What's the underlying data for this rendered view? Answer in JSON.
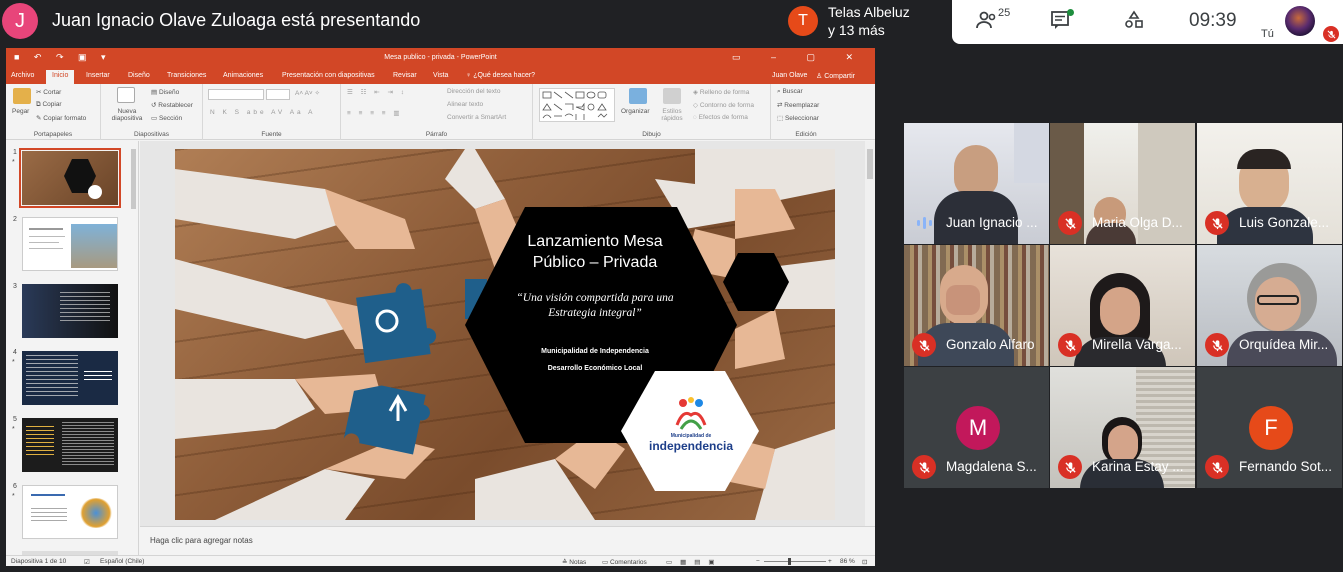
{
  "meet": {
    "presenter_initial": "J",
    "presenter_text": "Juan Ignacio Olave Zuloaga está presentando",
    "other_presentation": {
      "initial": "T",
      "line1": "Telas Albeluz",
      "line2": "y 13 más"
    },
    "participants_count": "25",
    "time": "09:39",
    "you_label": "Tú"
  },
  "powerpoint": {
    "window_title": "Mesa publico - privada - PowerPoint",
    "user": "Juan Olave",
    "share": "Compartir",
    "tabs": [
      "Archivo",
      "Inicio",
      "Insertar",
      "Diseño",
      "Transiciones",
      "Animaciones",
      "Presentación con diapositivas",
      "Revisar",
      "Vista",
      "¿Qué desea hacer?"
    ],
    "ribbon": {
      "paste": "Pegar",
      "cut": "Cortar",
      "copy": "Copiar",
      "format_painter": "Copiar formato",
      "clipboard": "Portapapeles",
      "new_slide": "Nueva diapositiva",
      "layout": "Diseño",
      "reset": "Restablecer",
      "section": "Sección",
      "slides": "Diapositivas",
      "font": "Fuente",
      "text_direction": "Dirección del texto",
      "align_text": "Alinear texto",
      "smartart": "Convertir a SmartArt",
      "paragraph": "Párrafo",
      "arrange": "Organizar",
      "quick_styles": "Estilos rápidos",
      "shape_fill": "Relleno de forma",
      "shape_outline": "Contorno de forma",
      "shape_effects": "Efectos de forma",
      "drawing": "Dibujo",
      "find": "Buscar",
      "replace": "Reemplazar",
      "select": "Seleccionar",
      "editing": "Edición"
    },
    "thumbnails": [
      {
        "num": "1",
        "star": "*"
      },
      {
        "num": "2",
        "star": ""
      },
      {
        "num": "3",
        "star": ""
      },
      {
        "num": "4",
        "star": "*"
      },
      {
        "num": "5",
        "star": "*"
      },
      {
        "num": "6",
        "star": "*"
      }
    ],
    "slide": {
      "title": "Lanzamiento Mesa Público – Privada",
      "subtitle": "“Una visión compartida para una Estrategia integral”",
      "line1": "Municipalidad de Independencia",
      "line2": "Desarrollo Económico Local",
      "logo_small": "Municipalidad de",
      "logo_big": "independencia"
    },
    "notes_placeholder": "Haga clic para agregar notas",
    "status": {
      "slide_count": "Diapositiva 1 de 10",
      "language": "Español (Chile)",
      "notes": "Notas",
      "comments": "Comentarios",
      "zoom": "86 %"
    }
  },
  "participants": [
    {
      "name": "Juan Ignacio ...",
      "muted": false,
      "speaking": true,
      "initial": ""
    },
    {
      "name": "Maria Olga D...",
      "muted": true,
      "speaking": false,
      "initial": ""
    },
    {
      "name": "Luis Gonzale...",
      "muted": true,
      "speaking": false,
      "initial": ""
    },
    {
      "name": "Gonzalo Alfaro",
      "muted": true,
      "speaking": false,
      "initial": ""
    },
    {
      "name": "Mirella Varga...",
      "muted": true,
      "speaking": false,
      "initial": ""
    },
    {
      "name": "Orquídea Mir...",
      "muted": true,
      "speaking": false,
      "initial": ""
    },
    {
      "name": "Magdalena S...",
      "muted": true,
      "speaking": false,
      "initial": "M"
    },
    {
      "name": "Karina Estay ...",
      "muted": true,
      "speaking": false,
      "initial": ""
    },
    {
      "name": "Fernando Sot...",
      "muted": true,
      "speaking": false,
      "initial": "F"
    }
  ],
  "colors": {
    "ppt_accent": "#d24726",
    "meet_bg": "#202124",
    "mute_red": "#d93025",
    "magdalena_avatar": "#c2185b",
    "fernando_avatar": "#e64a19"
  }
}
